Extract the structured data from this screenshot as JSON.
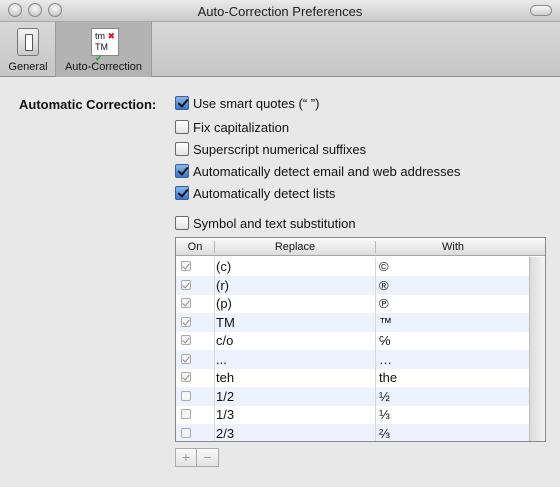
{
  "window": {
    "title": "Auto-Correction Preferences"
  },
  "toolbar": {
    "general_label": "General",
    "autocorrection_label": "Auto-Correction",
    "autocorr_icon": {
      "tm": "tm",
      "x": "✖",
      "TM": "TM",
      "check": "✔"
    }
  },
  "main": {
    "section_label": "Automatic Correction:",
    "options": [
      {
        "label": "Use smart quotes (“ ”)",
        "checked": true
      },
      {
        "label": "Fix capitalization",
        "checked": false
      },
      {
        "label": "Superscript numerical suffixes",
        "checked": false
      },
      {
        "label": "Automatically detect email and web addresses",
        "checked": true
      },
      {
        "label": "Automatically detect lists",
        "checked": true
      },
      {
        "label": "Symbol and text substitution",
        "checked": false
      }
    ],
    "table": {
      "columns": [
        "On",
        "Replace",
        "With"
      ],
      "rows": [
        {
          "on": true,
          "replace": "(c)",
          "with": "©"
        },
        {
          "on": true,
          "replace": "(r)",
          "with": "®"
        },
        {
          "on": true,
          "replace": "(p)",
          "with": "℗"
        },
        {
          "on": true,
          "replace": "TM",
          "with": "™"
        },
        {
          "on": true,
          "replace": "c/o",
          "with": "℅"
        },
        {
          "on": true,
          "replace": "...",
          "with": "…"
        },
        {
          "on": true,
          "replace": "teh",
          "with": "the"
        },
        {
          "on": false,
          "replace": "1/2",
          "with": "½"
        },
        {
          "on": false,
          "replace": "1/3",
          "with": "⅓"
        },
        {
          "on": false,
          "replace": "2/3",
          "with": "⅔"
        }
      ]
    },
    "add_label": "+",
    "remove_label": "−"
  }
}
